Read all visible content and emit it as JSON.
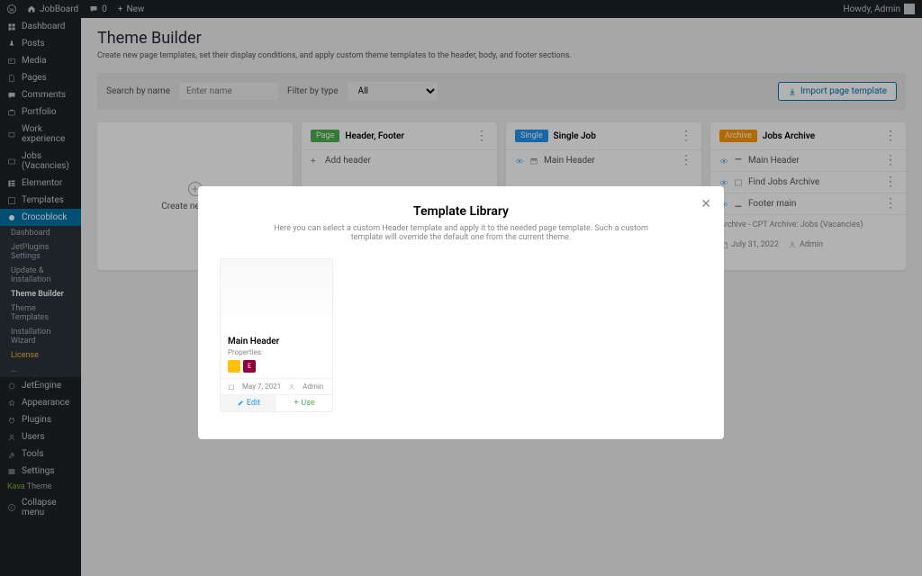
{
  "adminbar": {
    "site": "JobBoard",
    "comments": "0",
    "new": "New",
    "howdy": "Howdy, Admin"
  },
  "sidebar": {
    "items": [
      {
        "label": "Dashboard",
        "icon": "dashboard"
      },
      {
        "label": "Posts",
        "icon": "pin"
      },
      {
        "label": "Media",
        "icon": "media"
      },
      {
        "label": "Pages",
        "icon": "page"
      },
      {
        "label": "Comments",
        "icon": "comment"
      },
      {
        "label": "Portfolio",
        "icon": "portfolio"
      },
      {
        "label": "Work experience",
        "icon": "work"
      },
      {
        "label": "Jobs (Vacancies)",
        "icon": "jobs"
      },
      {
        "label": "Elementor",
        "icon": "elementor"
      },
      {
        "label": "Templates",
        "icon": "templates"
      },
      {
        "label": "Crocoblock",
        "icon": "crocoblock",
        "active": true
      }
    ],
    "sub": [
      {
        "label": "Dashboard"
      },
      {
        "label": "JetPlugins Settings"
      },
      {
        "label": "Update & Installation"
      },
      {
        "label": "Theme Builder",
        "active": true
      },
      {
        "label": "Theme Templates"
      },
      {
        "label": "Installation Wizard"
      },
      {
        "label": "License",
        "license": true
      },
      {
        "label": "...",
        "truncated": true
      }
    ],
    "items2": [
      {
        "label": "JetEngine",
        "icon": "engine"
      },
      {
        "label": "Appearance",
        "icon": "appearance"
      },
      {
        "label": "Plugins",
        "icon": "plugin"
      },
      {
        "label": "Users",
        "icon": "user"
      },
      {
        "label": "Tools",
        "icon": "tool"
      },
      {
        "label": "Settings",
        "icon": "settings"
      }
    ],
    "theme_prefix": "Kava",
    "theme_label": "Theme",
    "collapse": "Collapse menu"
  },
  "page": {
    "title": "Theme Builder",
    "desc": "Create new page templates, set their display conditions, and apply custom theme templates to the header, body, and footer sections."
  },
  "filter": {
    "search_label": "Search by name",
    "search_placeholder": "Enter name",
    "type_label": "Filter by type",
    "type_value": "All",
    "import": "Import page template"
  },
  "cards": {
    "create": "Create new page",
    "card1": {
      "badge": "Page",
      "title": "Header, Footer",
      "row1": "Add header"
    },
    "card2": {
      "badge": "Single",
      "title": "Single Job",
      "row1": "Main Header"
    },
    "card3": {
      "badge": "Archive",
      "title": "Jobs Archive",
      "row1": "Main Header",
      "row2": "Find Jobs Archive",
      "row3": "Footer main",
      "condition": "Archive - CPT Archive: Jobs (Vacancies)",
      "date": "July 31, 2022",
      "author": "Admin"
    }
  },
  "modal": {
    "title": "Template Library",
    "desc": "Here you can select a custom Header template and apply it to the needed page template. Such a custom template will override the default one from the current theme.",
    "template": {
      "name": "Main Header",
      "properties": "Properties:",
      "date": "May 7, 2021",
      "author": "Admin",
      "edit": "Edit",
      "use": "Use"
    }
  }
}
